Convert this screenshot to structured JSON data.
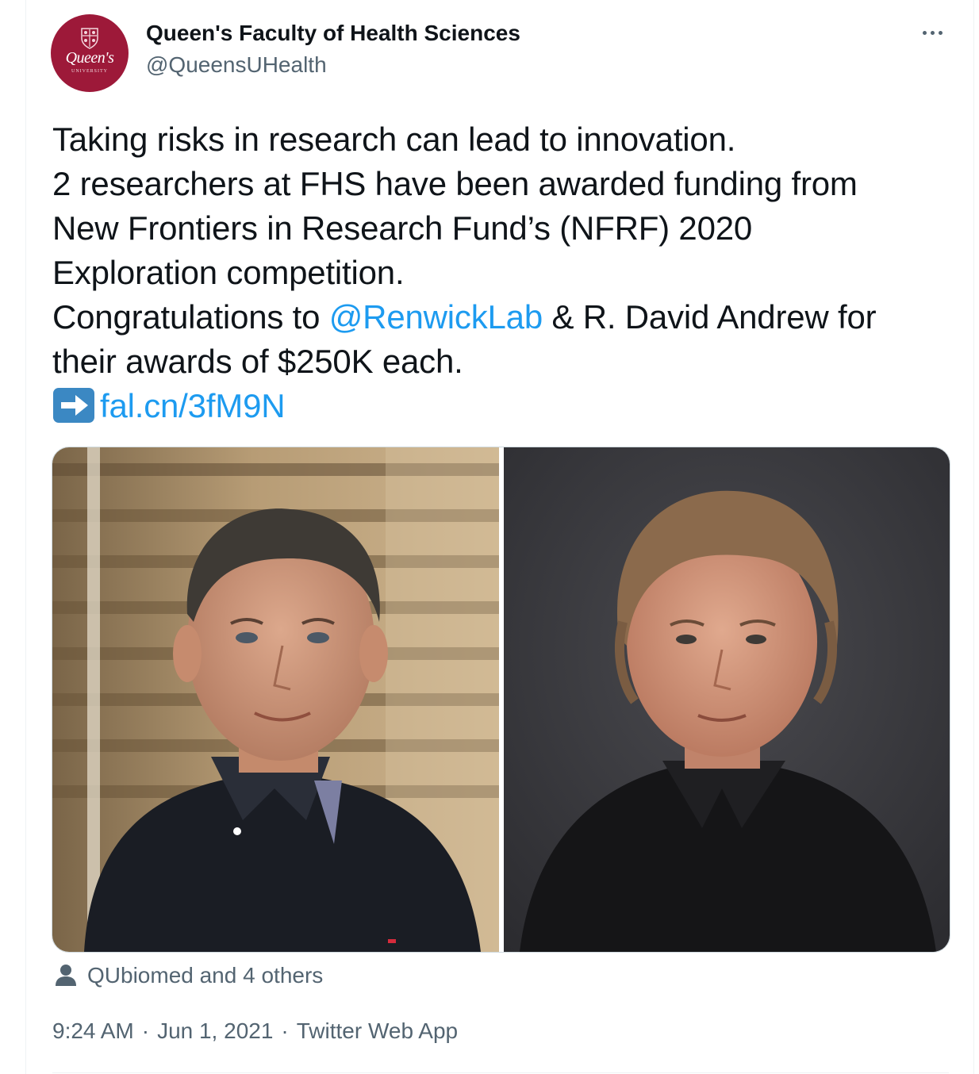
{
  "author": {
    "name": "Queen's Faculty of Health Sciences",
    "handle": "@QueensUHealth",
    "avatar_wordmark": "Queen's",
    "avatar_subtext": "UNIVERSITY",
    "avatar_color": "#9d1939"
  },
  "tweet": {
    "line1": "Taking risks in research can lead to innovation.",
    "line2": "2 researchers at FHS have been awarded funding from",
    "line3": "New Frontiers in Research Fund’s (NFRF) 2020",
    "line4": "Exploration competition.",
    "line5_prefix": "Congratulations to ",
    "mention": "@RenwickLab",
    "line5_suffix": " & R. David Andrew for",
    "line6": "their awards of $250K each.",
    "url": "fal.cn/3fM9N",
    "link_color": "#1d9bf0"
  },
  "media": {
    "photos": [
      {
        "alt_icon": "portrait-photo-left"
      },
      {
        "alt_icon": "portrait-photo-right"
      }
    ]
  },
  "liked_by": {
    "icon": "person-icon",
    "text": "QUbiomed and 4 others"
  },
  "meta": {
    "time": "9:24 AM",
    "date": "Jun 1, 2021",
    "source": "Twitter Web App",
    "separator": "·"
  }
}
